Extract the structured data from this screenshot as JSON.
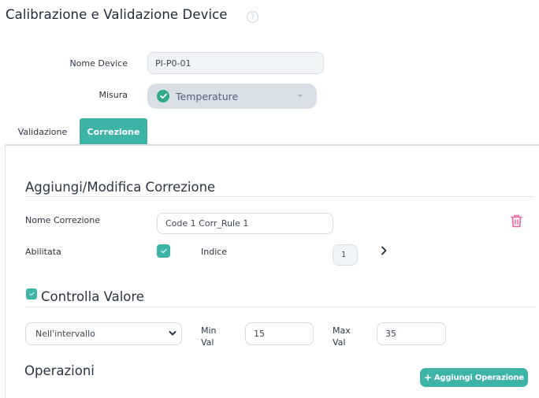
{
  "page": {
    "title": "Calibrazione e Validazione Device",
    "help_icon": "question-circle-icon"
  },
  "device_form": {
    "nome_device_label": "Nome Device",
    "nome_device_value": "PI-P0-01",
    "misura_label": "Misura",
    "misura_value": "Temperature",
    "misura_icon": "check-circle-icon"
  },
  "tabs": [
    {
      "label": "Validazione",
      "active": false
    },
    {
      "label": "Correzione",
      "active": true
    }
  ],
  "colors": {
    "accent": "#3db4a6",
    "danger": "#f06292",
    "text": "#2b3544"
  },
  "correzione": {
    "section_title": "Aggiungi/Modifica Correzione",
    "nome_correzione_label": "Nome Correzione",
    "nome_correzione_value": "Code 1 Corr_Rule 1",
    "abilitata_label": "Abilitata",
    "abilitata_checked": true,
    "indice_label": "Indice",
    "indice_value": "1",
    "delete_icon": "trash-icon",
    "next_icon": "chevron-right-icon"
  },
  "controlla_valore": {
    "checked": true,
    "title": "Controlla Valore",
    "condition_selected": "Nell'intervallo",
    "min_label_line1": "Min",
    "min_label_line2": "Val",
    "min_value": "15",
    "max_label_line1": "Max",
    "max_label_line2": "Val",
    "max_value": "35"
  },
  "operazioni": {
    "title": "Operazioni",
    "add_button_icon": "+",
    "add_button_label": "Aggiungi Operazione"
  }
}
